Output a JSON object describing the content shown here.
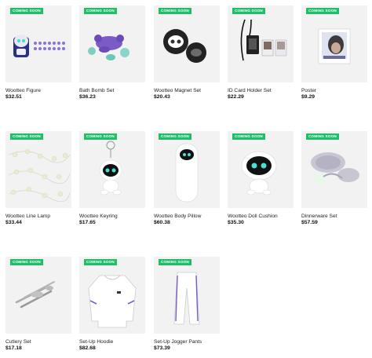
{
  "badge_text": "COMING SOON",
  "products": [
    {
      "name": "Wootteo Figure",
      "price": "$32.51",
      "icon": "figure-image"
    },
    {
      "name": "Bath Bomb Set",
      "price": "$36.23",
      "icon": "bath-bomb-image"
    },
    {
      "name": "Wootteo Magnet Set",
      "price": "$20.43",
      "icon": "magnet-image"
    },
    {
      "name": "ID Card Holder Set",
      "price": "$22.29",
      "icon": "card-holder-image"
    },
    {
      "name": "Poster",
      "price": "$9.29",
      "icon": "poster-image"
    },
    {
      "name": "Wootteo Line Lamp",
      "price": "$33.44",
      "icon": "line-lamp-image"
    },
    {
      "name": "Wootteo Keyring",
      "price": "$17.65",
      "icon": "keyring-image"
    },
    {
      "name": "Wootteo Body Pillow",
      "price": "$60.38",
      "icon": "body-pillow-image"
    },
    {
      "name": "Wootteo Doll Cushion",
      "price": "$35.30",
      "icon": "doll-cushion-image"
    },
    {
      "name": "Dinnerware Set",
      "price": "$57.59",
      "icon": "dinnerware-image"
    },
    {
      "name": "Cutlery Set",
      "price": "$17.18",
      "icon": "cutlery-image"
    },
    {
      "name": "Set-Up Hoodie",
      "price": "$82.68",
      "icon": "hoodie-image"
    },
    {
      "name": "Set-Up Jogger Pants",
      "price": "$73.39",
      "icon": "jogger-pants-image"
    }
  ],
  "colors": {
    "badge": "#1fbf6a",
    "thumb_bg": "#f2f2f3",
    "accent_purple": "#7a5cc7"
  }
}
